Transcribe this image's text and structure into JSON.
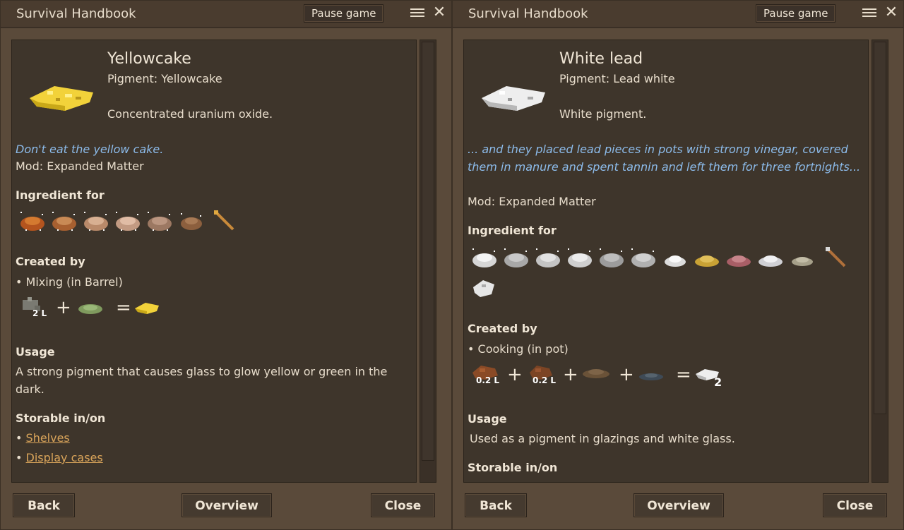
{
  "left": {
    "title": "Survival Handbook",
    "pause_label": "Pause game",
    "item_name": "Yellowcake",
    "pigment": "Pigment: Yellowcake",
    "description": "Concentrated uranium oxide.",
    "lore": "Don't eat the yellow cake.",
    "mod": "Mod: Expanded Matter",
    "ingredient_heading": "Ingredient for",
    "created_heading": "Created by",
    "created_method": "• Mixing (in Barrel)",
    "recipe_qty": "2 L",
    "usage_heading": "Usage",
    "usage_text": "A strong pigment that causes glass to glow yellow or green in the dark.",
    "storable_heading": "Storable in/on",
    "storable": [
      "Shelves",
      "Display cases"
    ],
    "buttons": {
      "back": "Back",
      "overview": "Overview",
      "close": "Close"
    }
  },
  "right": {
    "title": "Survival Handbook",
    "pause_label": "Pause game",
    "item_name": "White lead",
    "pigment": "Pigment: Lead white",
    "description": "White pigment.",
    "lore": "... and they placed lead pieces in pots with strong vinegar, covered them in manure and spent tannin and left them for three fortnights...",
    "mod": "Mod: Expanded Matter",
    "ingredient_heading": "Ingredient for",
    "created_heading": "Created by",
    "created_method": "• Cooking (in pot)",
    "recipe_qty1": "0.2 L",
    "recipe_qty2": "0.2 L",
    "recipe_out": "2",
    "usage_heading": "Usage",
    "usage_text": "Used as a pigment in glazings and white glass.",
    "storable_heading": "Storable in/on",
    "buttons": {
      "back": "Back",
      "overview": "Overview",
      "close": "Close"
    }
  },
  "ops": {
    "plus": "+",
    "equals": "="
  },
  "colors": {
    "lore": "#8cbbea",
    "link": "#d9a45a",
    "yellowcake": "#f2d23a",
    "whitelead": "#eeeeee"
  }
}
